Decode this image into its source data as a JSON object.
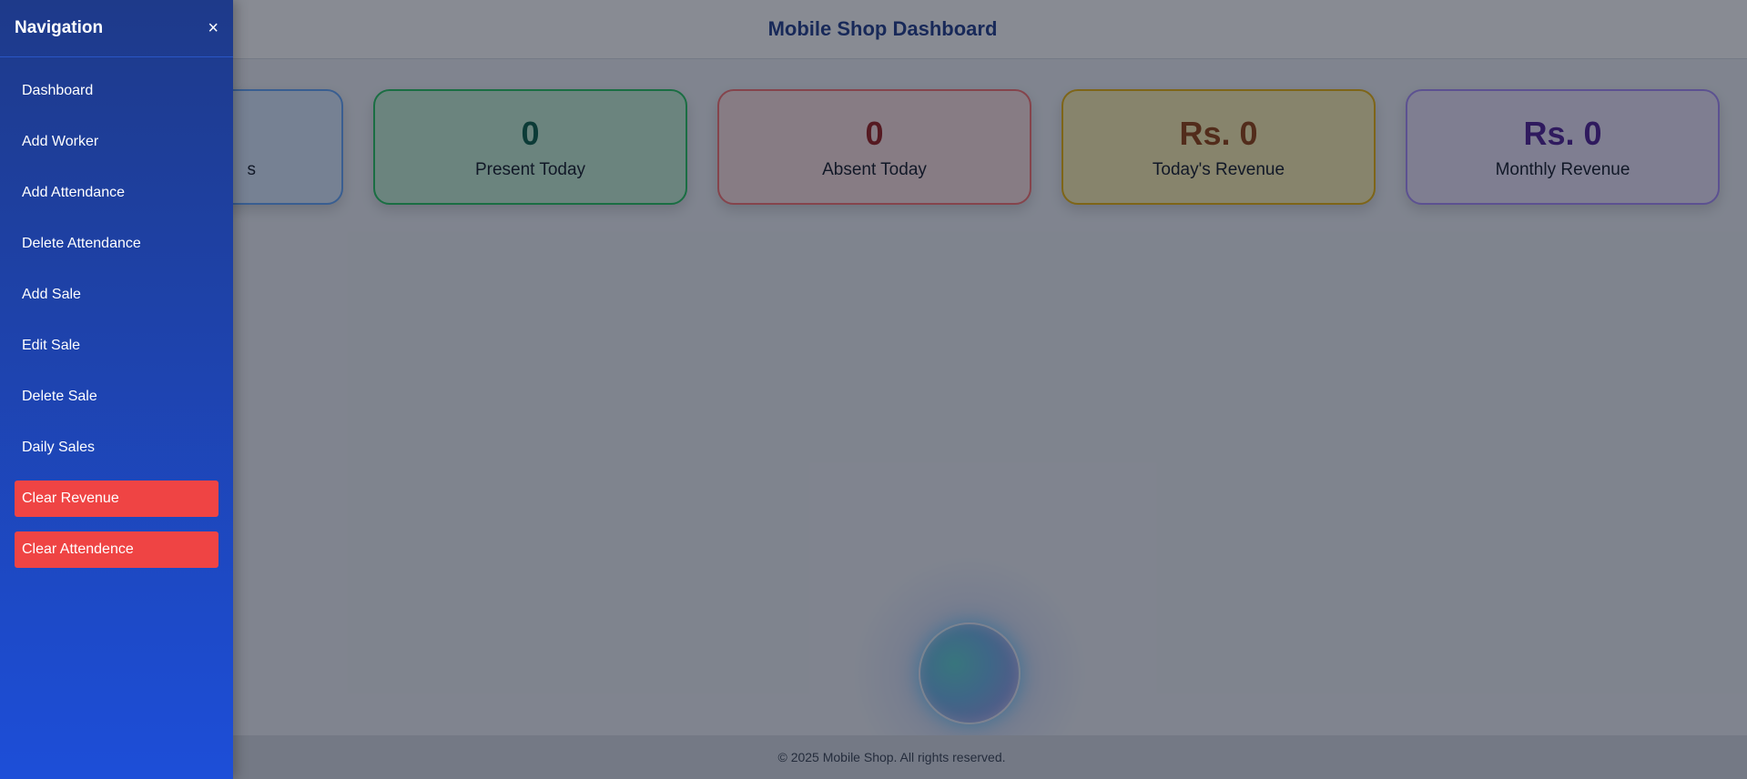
{
  "header": {
    "title": "Mobile Shop Dashboard"
  },
  "cards": [
    {
      "value": "",
      "label": "s",
      "color": "#60a5fa"
    },
    {
      "value": "0",
      "label": "Present Today",
      "color": "#22c55e"
    },
    {
      "value": "0",
      "label": "Absent Today",
      "color": "#f87171"
    },
    {
      "value": "Rs. 0",
      "label": "Today's Revenue",
      "color": "#eab308"
    },
    {
      "value": "Rs. 0",
      "label": "Monthly Revenue",
      "color": "#a78bfa"
    }
  ],
  "sidebar": {
    "title": "Navigation",
    "close_label": "×",
    "items": [
      {
        "label": "Dashboard"
      },
      {
        "label": "Add Worker"
      },
      {
        "label": "Add Attendance"
      },
      {
        "label": "Delete Attendance"
      },
      {
        "label": "Add Sale"
      },
      {
        "label": "Edit Sale"
      },
      {
        "label": "Delete Sale"
      },
      {
        "label": "Daily Sales"
      },
      {
        "label": "Clear Revenue",
        "color": "#ef4444"
      },
      {
        "label": "Clear Attendence",
        "color": "#ef4444"
      }
    ]
  },
  "footer": {
    "text": "© 2025 Mobile Shop. All rights reserved."
  }
}
